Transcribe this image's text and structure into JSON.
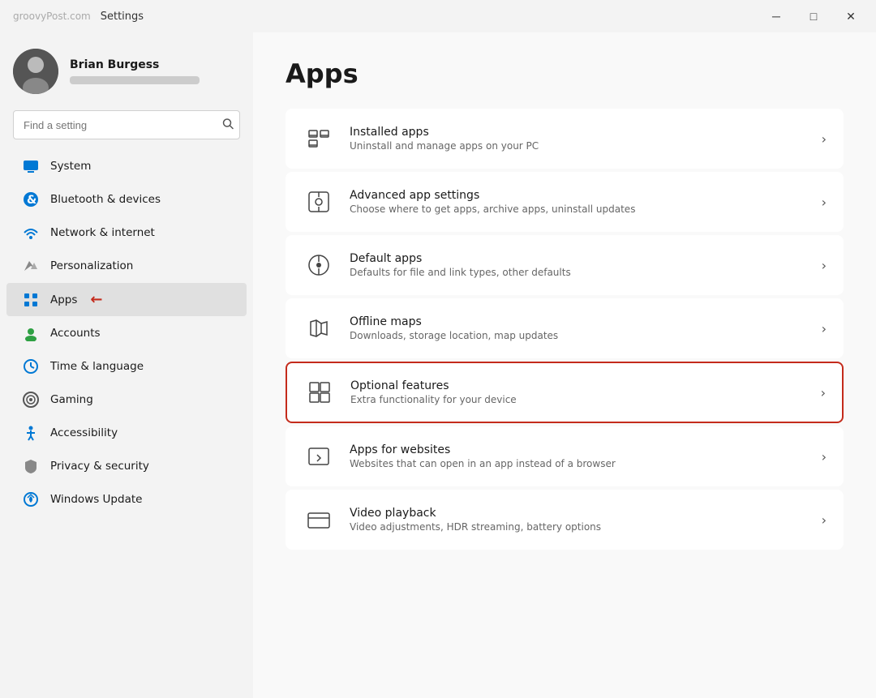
{
  "titleBar": {
    "title": "Settings",
    "minimize": "─",
    "maximize": "□",
    "close": "✕"
  },
  "watermark": "groovyPost.com",
  "sidebar": {
    "user": {
      "name": "Brian Burgess",
      "email": "••••••••••••"
    },
    "search": {
      "placeholder": "Find a setting"
    },
    "navItems": [
      {
        "id": "system",
        "label": "System",
        "iconColor": "#0078d4"
      },
      {
        "id": "bluetooth",
        "label": "Bluetooth & devices",
        "iconColor": "#0078d4"
      },
      {
        "id": "network",
        "label": "Network & internet",
        "iconColor": "#0078d4"
      },
      {
        "id": "personalization",
        "label": "Personalization",
        "iconColor": "#888"
      },
      {
        "id": "apps",
        "label": "Apps",
        "iconColor": "#0078d4",
        "active": true
      },
      {
        "id": "accounts",
        "label": "Accounts",
        "iconColor": "#2ea043"
      },
      {
        "id": "time",
        "label": "Time & language",
        "iconColor": "#0078d4"
      },
      {
        "id": "gaming",
        "label": "Gaming",
        "iconColor": "#555"
      },
      {
        "id": "accessibility",
        "label": "Accessibility",
        "iconColor": "#0078d4"
      },
      {
        "id": "privacy",
        "label": "Privacy & security",
        "iconColor": "#555"
      },
      {
        "id": "windowsupdate",
        "label": "Windows Update",
        "iconColor": "#0078d4"
      }
    ]
  },
  "main": {
    "title": "Apps",
    "items": [
      {
        "id": "installed-apps",
        "title": "Installed apps",
        "desc": "Uninstall and manage apps on your PC",
        "highlighted": false
      },
      {
        "id": "advanced-app-settings",
        "title": "Advanced app settings",
        "desc": "Choose where to get apps, archive apps, uninstall updates",
        "highlighted": false
      },
      {
        "id": "default-apps",
        "title": "Default apps",
        "desc": "Defaults for file and link types, other defaults",
        "highlighted": false
      },
      {
        "id": "offline-maps",
        "title": "Offline maps",
        "desc": "Downloads, storage location, map updates",
        "highlighted": false
      },
      {
        "id": "optional-features",
        "title": "Optional features",
        "desc": "Extra functionality for your device",
        "highlighted": true
      },
      {
        "id": "apps-for-websites",
        "title": "Apps for websites",
        "desc": "Websites that can open in an app instead of a browser",
        "highlighted": false
      },
      {
        "id": "video-playback",
        "title": "Video playback",
        "desc": "Video adjustments, HDR streaming, battery options",
        "highlighted": false
      }
    ]
  }
}
